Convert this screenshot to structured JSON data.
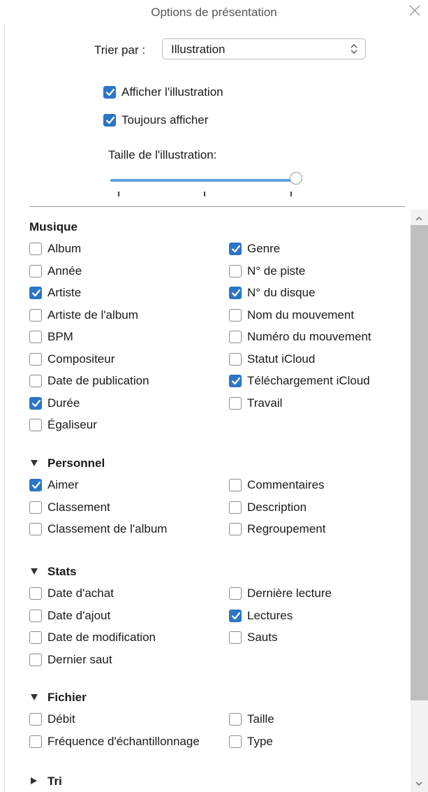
{
  "window": {
    "title": "Options de présentation"
  },
  "sort": {
    "label": "Trier par :",
    "value": "Illustration"
  },
  "display_options": [
    {
      "label": "Afficher l'illustration",
      "checked": true
    },
    {
      "label": "Toujours afficher",
      "checked": true
    }
  ],
  "artwork_size": {
    "label": "Taille de l'illustration:",
    "value": 1.0
  },
  "sections": [
    {
      "title": "Musique",
      "has_triangle": false,
      "expanded": true,
      "columns": [
        [
          {
            "label": "Album",
            "checked": false
          },
          {
            "label": "Année",
            "checked": false
          },
          {
            "label": "Artiste",
            "checked": true
          },
          {
            "label": "Artiste de l'album",
            "checked": false
          },
          {
            "label": "BPM",
            "checked": false
          },
          {
            "label": "Compositeur",
            "checked": false
          },
          {
            "label": "Date de publication",
            "checked": false
          },
          {
            "label": "Durée",
            "checked": true
          },
          {
            "label": "Égaliseur",
            "checked": false
          }
        ],
        [
          {
            "label": "Genre",
            "checked": true
          },
          {
            "label": "N° de piste",
            "checked": false
          },
          {
            "label": "N° du disque",
            "checked": true
          },
          {
            "label": "Nom du mouvement",
            "checked": false
          },
          {
            "label": "Numéro du mouvement",
            "checked": false
          },
          {
            "label": "Statut iCloud",
            "checked": false
          },
          {
            "label": "Téléchargement iCloud",
            "checked": true
          },
          {
            "label": "Travail",
            "checked": false
          }
        ]
      ]
    },
    {
      "title": "Personnel",
      "has_triangle": true,
      "expanded": true,
      "columns": [
        [
          {
            "label": "Aimer",
            "checked": true
          },
          {
            "label": "Classement",
            "checked": false
          },
          {
            "label": "Classement de l'album",
            "checked": false
          }
        ],
        [
          {
            "label": "Commentaires",
            "checked": false
          },
          {
            "label": "Description",
            "checked": false
          },
          {
            "label": "Regroupement",
            "checked": false
          }
        ]
      ]
    },
    {
      "title": "Stats",
      "has_triangle": true,
      "expanded": true,
      "columns": [
        [
          {
            "label": "Date d'achat",
            "checked": false
          },
          {
            "label": "Date d'ajout",
            "checked": false
          },
          {
            "label": "Date de modification",
            "checked": false
          },
          {
            "label": "Dernier saut",
            "checked": false
          }
        ],
        [
          {
            "label": "Dernière lecture",
            "checked": false
          },
          {
            "label": "Lectures",
            "checked": true
          },
          {
            "label": "Sauts",
            "checked": false
          }
        ]
      ]
    },
    {
      "title": "Fichier",
      "has_triangle": true,
      "expanded": true,
      "columns": [
        [
          {
            "label": "Débit",
            "checked": false
          },
          {
            "label": "Fréquence d'échantillonnage",
            "checked": false
          }
        ],
        [
          {
            "label": "Taille",
            "checked": false
          },
          {
            "label": "Type",
            "checked": false
          }
        ]
      ]
    },
    {
      "title": "Tri",
      "has_triangle": true,
      "expanded": false,
      "columns": []
    }
  ],
  "colors": {
    "accent": "#2c76c8",
    "scrollbar_thumb": "#bfbfbf"
  }
}
